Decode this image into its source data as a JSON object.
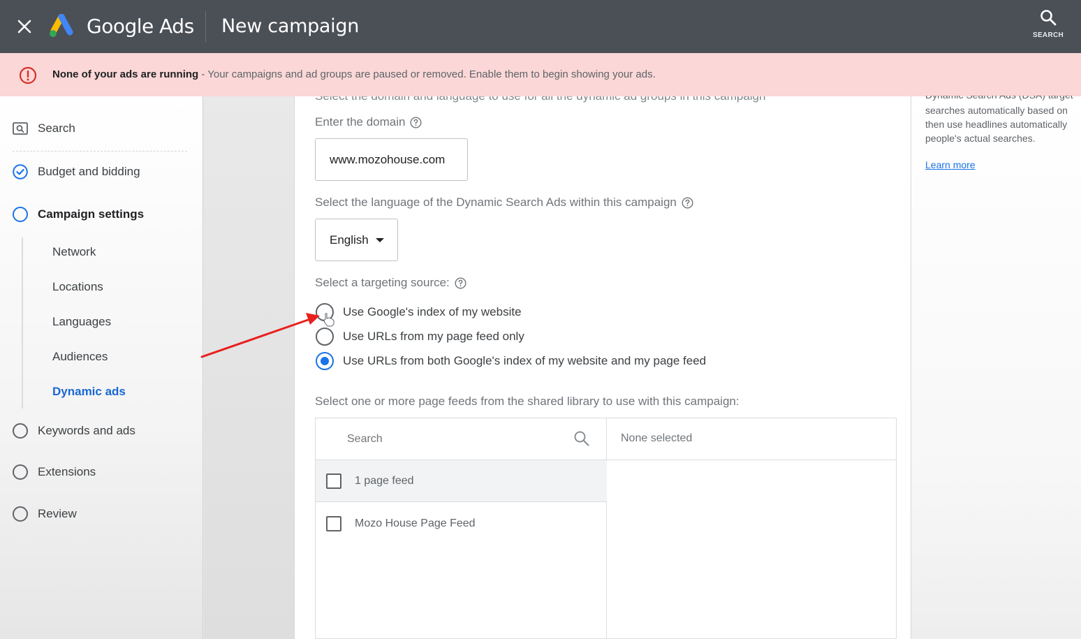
{
  "app": {
    "brand": "Google Ads",
    "title": "New campaign",
    "search_label": "SEARCH",
    "close_icon": "close-icon",
    "logo_icon": "google-ads-logo"
  },
  "banner": {
    "icon": "error-icon",
    "strong": "None of your ads are running",
    "text": " - Your campaigns and ad groups are paused or removed. Enable them to begin showing your ads."
  },
  "sidebar": {
    "search": "Search",
    "items": [
      {
        "label": "Budget and bidding",
        "state": "complete"
      },
      {
        "label": "Campaign settings",
        "state": "current"
      },
      {
        "label": "Keywords and ads",
        "state": "todo"
      },
      {
        "label": "Extensions",
        "state": "todo"
      },
      {
        "label": "Review",
        "state": "todo"
      }
    ],
    "sub_items": [
      "Network",
      "Locations",
      "Languages",
      "Audiences",
      "Dynamic ads"
    ],
    "active_sub": "Dynamic ads"
  },
  "main": {
    "cut_text": "Select the domain and language to use for all the dynamic ad groups in this campaign",
    "domain_label": "Enter the domain",
    "domain_value": "www.mozohouse.com",
    "language_label": "Select the language of the Dynamic Search Ads within this campaign",
    "language_value": "English",
    "targeting_label": "Select a targeting source:",
    "targeting_options": [
      {
        "label": "Use Google's index of my website",
        "selected": false
      },
      {
        "label": "Use URLs from my page feed only",
        "selected": false
      },
      {
        "label": "Use URLs from both Google's index of my website and my page feed",
        "selected": true
      }
    ],
    "feeds_label": "Select one or more page feeds from the shared library to use with this campaign:",
    "feeds_search_placeholder": "Search",
    "feeds_header": "1 page feed",
    "feeds": [
      "Mozo House Page Feed"
    ],
    "selected_text": "None selected"
  },
  "right_panel": {
    "cut_line": "Dynamic Search Ads (DSA) target",
    "lines": [
      "searches automatically based on",
      "then use headlines automatically",
      "people's actual searches."
    ],
    "link": "Learn more"
  },
  "colors": {
    "topbar": "#4b4f56",
    "banner": "#fbd7d7",
    "accent": "#1a73e8",
    "error": "#d93025",
    "annotation_arrow": "#e8201c"
  }
}
